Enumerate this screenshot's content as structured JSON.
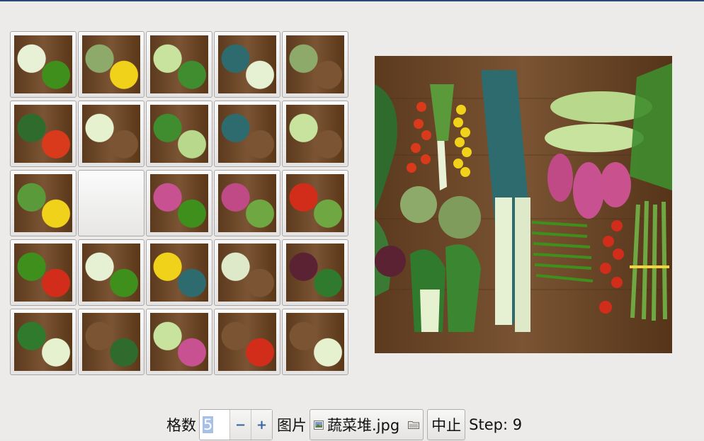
{
  "puzzle": {
    "rows": 5,
    "cols": 5,
    "blank_index": 11,
    "tiles": [
      "leek-beans",
      "artichoke-top",
      "lettuce-dill",
      "leek-stalks",
      "artichoke-right",
      "chard-tomatoes",
      "bokchoy-root",
      "dill-lettuce",
      "leek-edge",
      "lettuce-edge",
      "leek-yellow-tomato",
      "",
      "sweet-potato",
      "sweet-potato-asparagus",
      "tomato-asparagus",
      "green-beans-tomato",
      "leek-beans-bottom",
      "yellow-tomatoes-leek",
      "leek-roots",
      "beetroot-bokchoy",
      "bokchoy-bottom",
      "chard-bottom",
      "lettuce-sweet-potato",
      "tomato-corner",
      "bokchoy-corner"
    ]
  },
  "toolbar": {
    "grid_label": "格数",
    "grid_value": "5",
    "minus_label": "−",
    "plus_label": "+",
    "image_label": "图片",
    "file_name": "蔬菜堆.jpg",
    "stop_label": "中止",
    "step_text": "Step: 9"
  },
  "colors": {
    "accent": "#3465a4",
    "wood": "#6a4627",
    "selection": "#a8c0e8"
  }
}
